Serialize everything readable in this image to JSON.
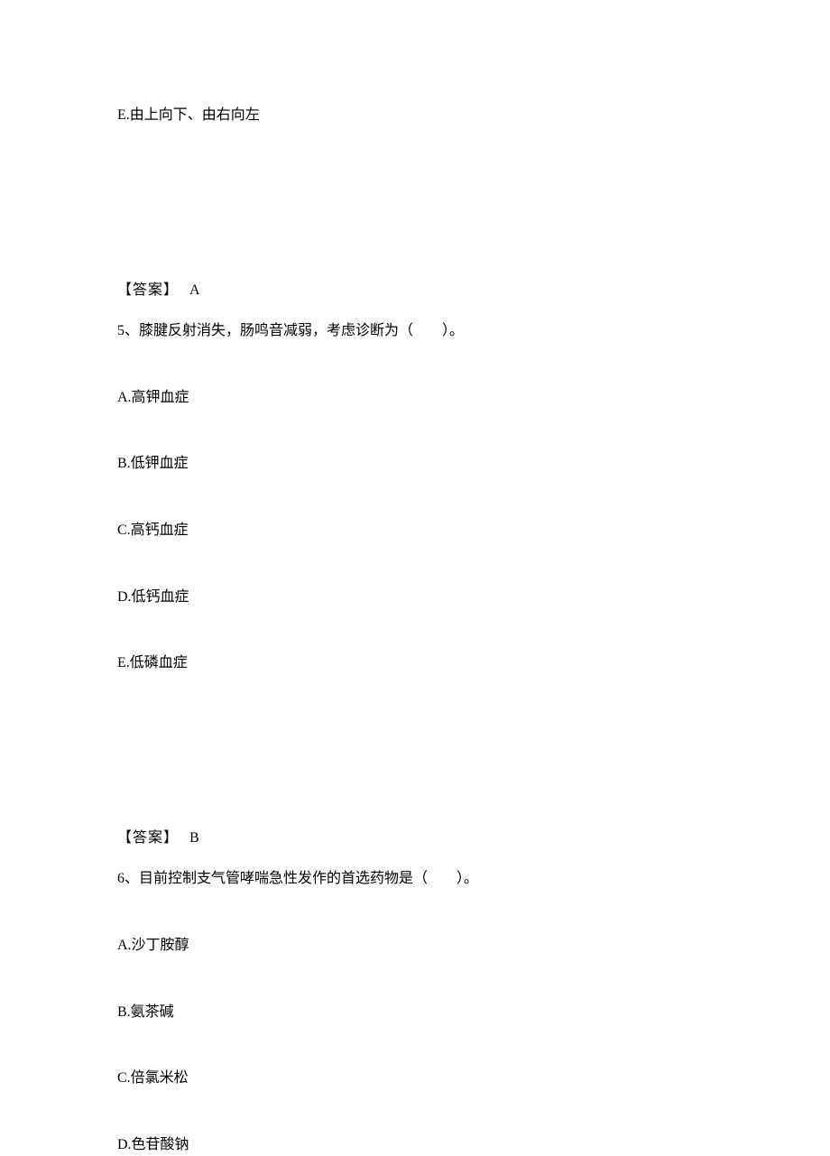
{
  "q4": {
    "optionE": "E.由上向下、由右向左",
    "answerLabel": "【答案】",
    "answerValue": "A"
  },
  "q5": {
    "question": "5、膝腱反射消失，肠鸣音减弱，考虑诊断为（　　）。",
    "optionA": "A.高钾血症",
    "optionB": "B.低钾血症",
    "optionC": "C.高钙血症",
    "optionD": "D.低钙血症",
    "optionE": "E.低磷血症",
    "answerLabel": "【答案】",
    "answerValue": "B"
  },
  "q6": {
    "question": "6、目前控制支气管哮喘急性发作的首选药物是（　　）。",
    "optionA": "A.沙丁胺醇",
    "optionB": "B.氨茶碱",
    "optionC": "C.倍氯米松",
    "optionD": "D.色苷酸钠"
  }
}
